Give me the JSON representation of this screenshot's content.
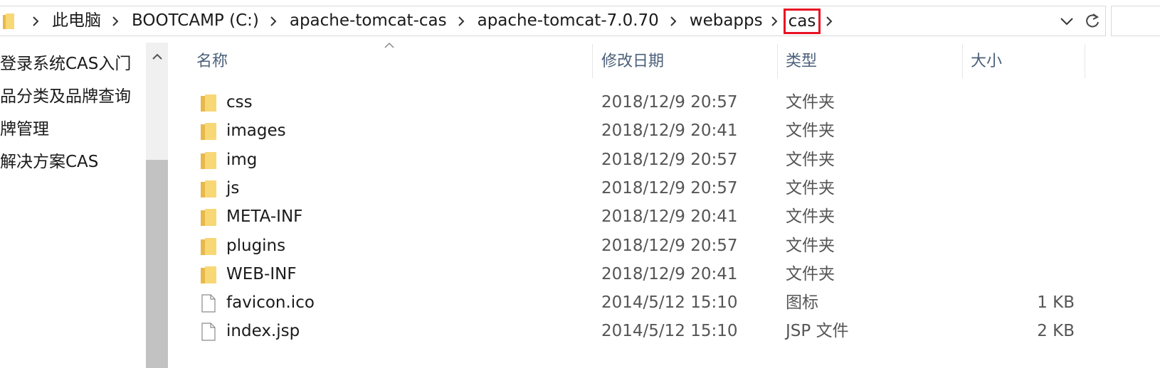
{
  "breadcrumb": {
    "items": [
      "此电脑",
      "BOOTCAMP (C:)",
      "apache-tomcat-cas",
      "apache-tomcat-7.0.70",
      "webapps",
      "cas"
    ]
  },
  "highlight_color": "#e81123",
  "icons": {
    "folder": "folder-icon",
    "file": "file-icon",
    "chevron": "chevron-right-icon",
    "dropdown": "chevron-down-icon",
    "refresh": "refresh-icon",
    "sort": "sort-caret-icon"
  },
  "nav": {
    "items": [
      "登录系统CAS入门",
      "品分类及品牌查询",
      "牌管理",
      "解决方案CAS"
    ]
  },
  "columns": {
    "name": "名称",
    "modified": "修改日期",
    "type": "类型",
    "size": "大小"
  },
  "files": [
    {
      "name": "css",
      "modified": "2018/12/9 20:57",
      "type": "文件夹",
      "size": "",
      "kind": "folder"
    },
    {
      "name": "images",
      "modified": "2018/12/9 20:41",
      "type": "文件夹",
      "size": "",
      "kind": "folder"
    },
    {
      "name": "img",
      "modified": "2018/12/9 20:57",
      "type": "文件夹",
      "size": "",
      "kind": "folder"
    },
    {
      "name": "js",
      "modified": "2018/12/9 20:57",
      "type": "文件夹",
      "size": "",
      "kind": "folder"
    },
    {
      "name": "META-INF",
      "modified": "2018/12/9 20:41",
      "type": "文件夹",
      "size": "",
      "kind": "folder"
    },
    {
      "name": "plugins",
      "modified": "2018/12/9 20:57",
      "type": "文件夹",
      "size": "",
      "kind": "folder"
    },
    {
      "name": "WEB-INF",
      "modified": "2018/12/9 20:41",
      "type": "文件夹",
      "size": "",
      "kind": "folder"
    },
    {
      "name": "favicon.ico",
      "modified": "2014/5/12 15:10",
      "type": "图标",
      "size": "1 KB",
      "kind": "file"
    },
    {
      "name": "index.jsp",
      "modified": "2014/5/12 15:10",
      "type": "JSP 文件",
      "size": "2 KB",
      "kind": "file"
    }
  ]
}
